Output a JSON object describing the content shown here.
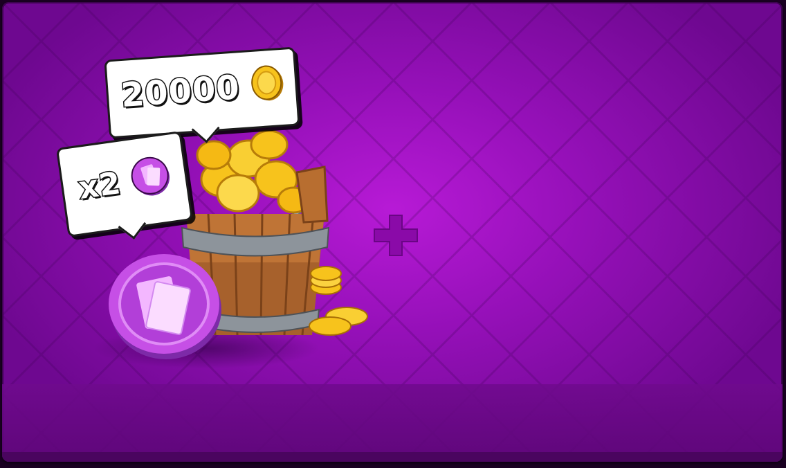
{
  "offer": {
    "gold_amount": "20000",
    "gold_icon": "gold-coin-icon",
    "cards_multiplier": "x2",
    "cards_icon": "card-token-icon",
    "bundle_separator_icon": "plus-icon"
  },
  "colors": {
    "background_center": "#b71ad6",
    "background_edge": "#6e0890",
    "bubble_fill": "#ffffff",
    "gold": "#f7c31c",
    "card_token": "#c64fe6"
  }
}
